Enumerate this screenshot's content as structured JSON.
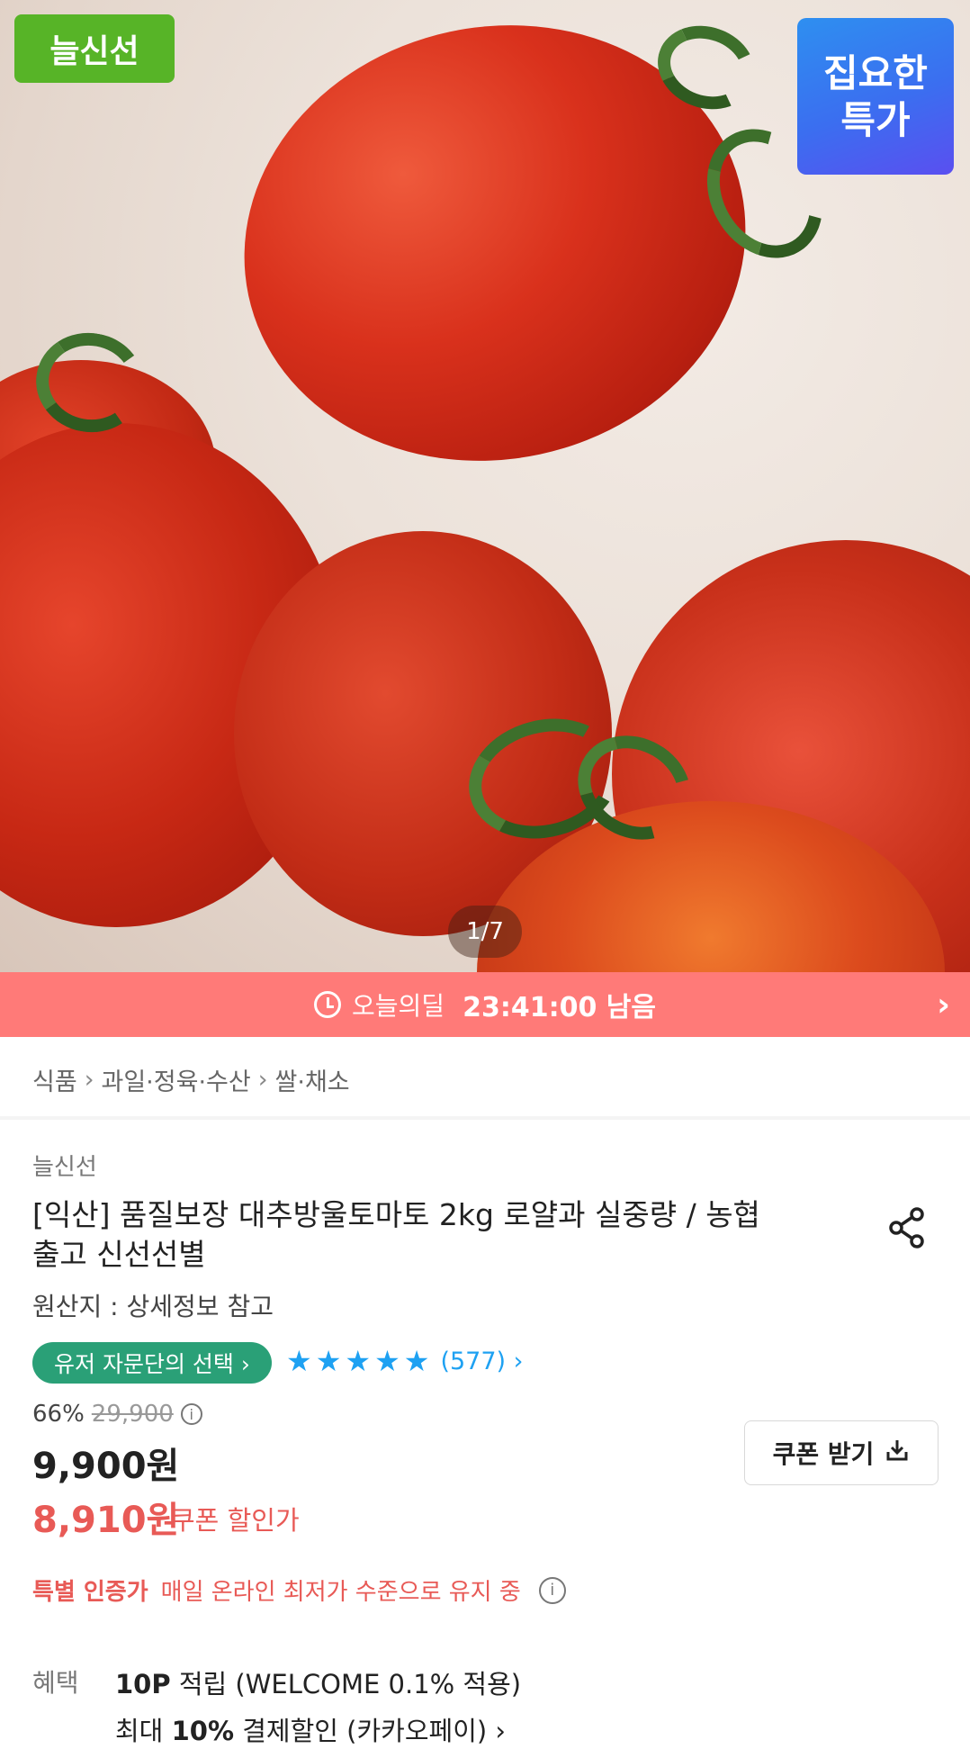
{
  "hero": {
    "brand_badge": "늘신선",
    "deal_badge_line1": "집요한",
    "deal_badge_line2": "특가",
    "pager": "1/7"
  },
  "today_deal": {
    "label": "오늘의딜",
    "countdown": "23:41:00 남음",
    "icon": "clock-icon",
    "arrow": "›"
  },
  "breadcrumb": [
    "식품",
    "과일·정육·수산",
    "쌀·채소"
  ],
  "product": {
    "seller": "늘신선",
    "title": "[익산] 품질보장 대추방울토마토 2kg 로얄과 실중량 / 농협출고 신선선별",
    "origin": "원산지 : 상세정보 참고",
    "advisor_badge": "유저 자문단의 선택  ›",
    "rating_stars": 5,
    "review_count": "(577) ›",
    "discount_rate": "66%",
    "original_price": "29,900",
    "price": "9,900원",
    "coupon_price": "8,910원",
    "coupon_price_label": "쿠폰 할인가",
    "coupon_button": "쿠폰 받기",
    "special_title": "특별 인증가",
    "special_desc": "매일 온라인 최저가 수준으로 유지 중"
  },
  "benefits": {
    "label": "혜택",
    "line1_strong": "10P",
    "line1_rest": " 적립 (WELCOME 0.1% 적용)",
    "line2_pre": "최대 ",
    "line2_strong": "10%",
    "line2_rest": " 결제할인 (카카오페이) ›"
  },
  "colors": {
    "deal_bar": "#ff7a78",
    "brand_green": "#57b427",
    "advisor_green": "#2aa077",
    "star_blue": "#1ea1f2",
    "sale_red": "#e85a56"
  }
}
